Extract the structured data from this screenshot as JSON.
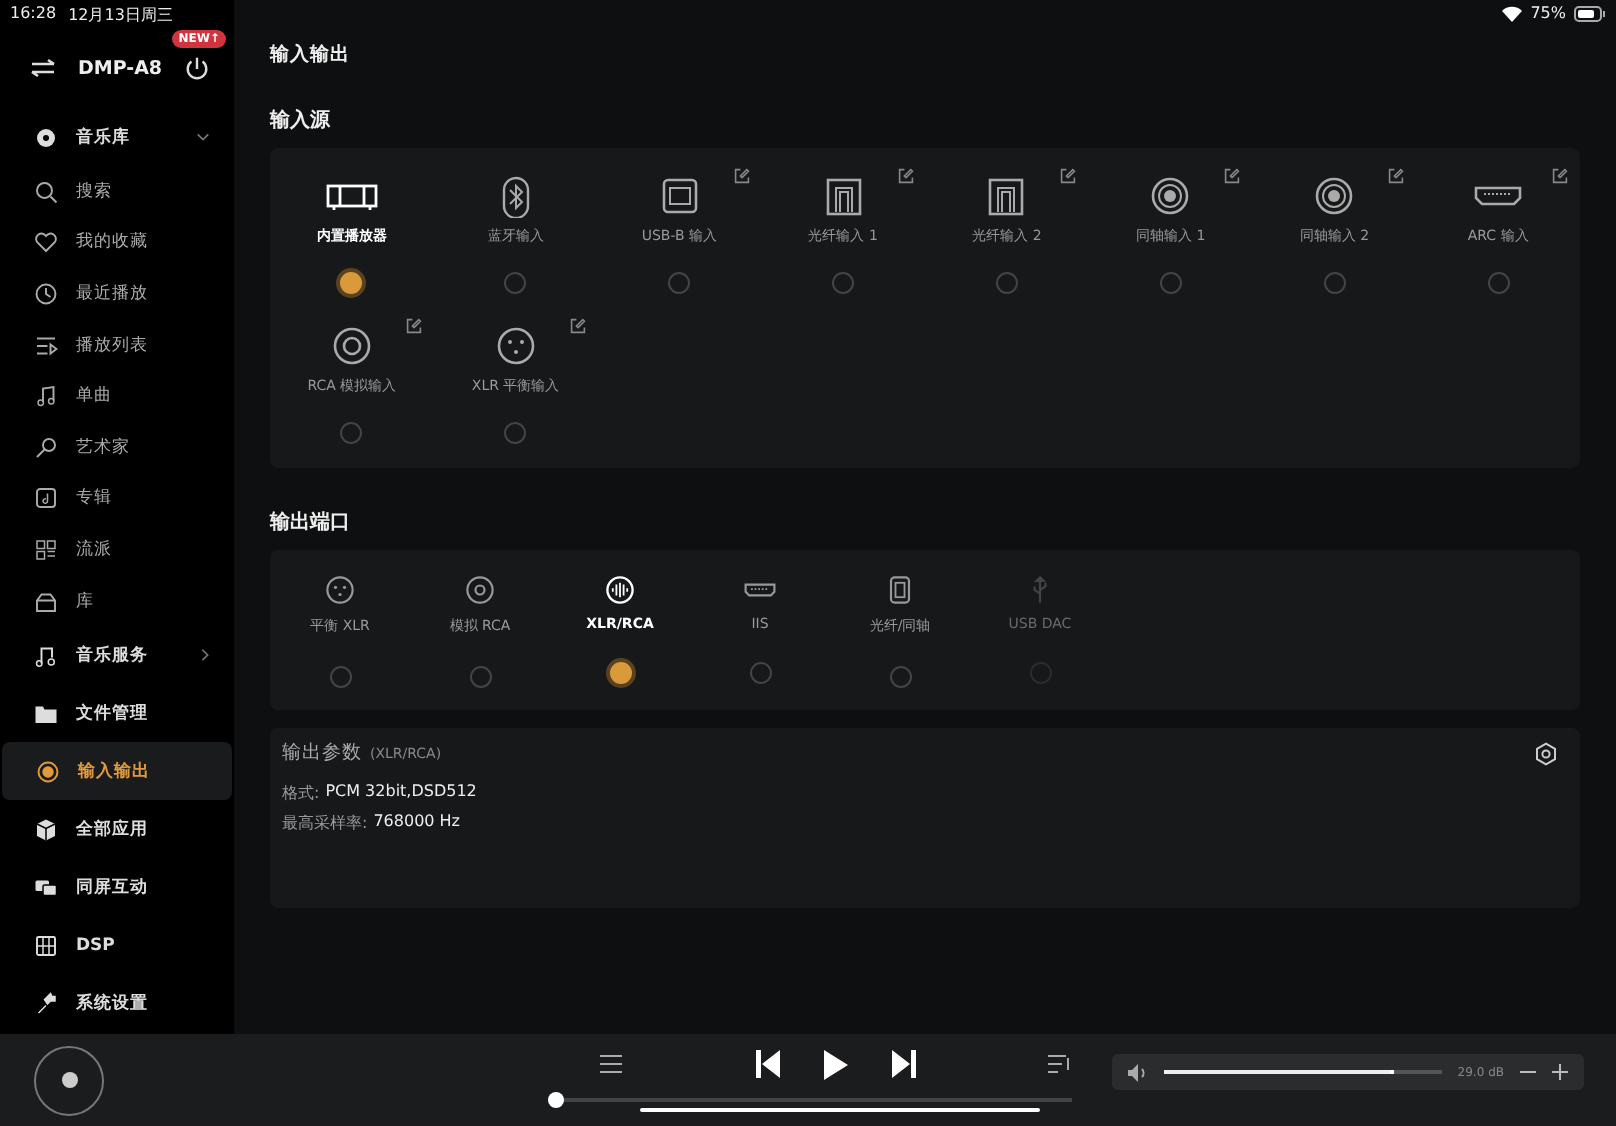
{
  "status_bar": {
    "time": "16:28",
    "date": "12月13日周三",
    "battery": "75%"
  },
  "sidebar": {
    "device": "DMP-A8",
    "badge": "NEW↑",
    "items": [
      {
        "label": "音乐库",
        "kind": "section",
        "expanded": true,
        "selected": false
      },
      {
        "label": "搜索",
        "kind": "item",
        "selected": false
      },
      {
        "label": "我的收藏",
        "kind": "item",
        "selected": false
      },
      {
        "label": "最近播放",
        "kind": "item",
        "selected": false
      },
      {
        "label": "播放列表",
        "kind": "item",
        "selected": false
      },
      {
        "label": "单曲",
        "kind": "item",
        "selected": false
      },
      {
        "label": "艺术家",
        "kind": "item",
        "selected": false
      },
      {
        "label": "专辑",
        "kind": "item",
        "selected": false
      },
      {
        "label": "流派",
        "kind": "item",
        "selected": false
      },
      {
        "label": "库",
        "kind": "item",
        "selected": false
      },
      {
        "label": "音乐服务",
        "kind": "section",
        "expanded": false,
        "selected": false
      },
      {
        "label": "文件管理",
        "kind": "section",
        "selected": false
      },
      {
        "label": "输入输出",
        "kind": "section",
        "selected": true
      },
      {
        "label": "全部应用",
        "kind": "section",
        "selected": false
      },
      {
        "label": "同屏互动",
        "kind": "section",
        "selected": false
      },
      {
        "label": "DSP",
        "kind": "section",
        "selected": false
      },
      {
        "label": "系统设置",
        "kind": "section",
        "selected": false
      }
    ]
  },
  "page_title": "输入输出",
  "inputs": {
    "heading": "输入源",
    "items": [
      {
        "label": "内置播放器",
        "editable": false,
        "selected": true
      },
      {
        "label": "蓝牙输入",
        "editable": false,
        "selected": false
      },
      {
        "label": "USB-B 输入",
        "editable": true,
        "selected": false
      },
      {
        "label": "光纤输入 1",
        "editable": true,
        "selected": false
      },
      {
        "label": "光纤输入 2",
        "editable": true,
        "selected": false
      },
      {
        "label": "同轴输入 1",
        "editable": true,
        "selected": false
      },
      {
        "label": "同轴输入 2",
        "editable": true,
        "selected": false
      },
      {
        "label": "ARC 输入",
        "editable": true,
        "selected": false
      },
      {
        "label": "RCA 模拟输入",
        "editable": true,
        "selected": false
      },
      {
        "label": "XLR 平衡输入",
        "editable": true,
        "selected": false
      }
    ]
  },
  "outputs": {
    "heading": "输出端口",
    "items": [
      {
        "label": "平衡 XLR",
        "disabled": false,
        "selected": false
      },
      {
        "label": "模拟 RCA",
        "disabled": false,
        "selected": false
      },
      {
        "label": "XLR/RCA",
        "disabled": false,
        "selected": true
      },
      {
        "label": "IIS",
        "disabled": false,
        "selected": false
      },
      {
        "label": "光纤/同轴",
        "disabled": false,
        "selected": false
      },
      {
        "label": "USB DAC",
        "disabled": true,
        "selected": false
      }
    ]
  },
  "output_params": {
    "title": "输出参数",
    "subtitle": "(XLR/RCA)",
    "rows": [
      {
        "label": "格式:",
        "value": "PCM 32bit,DSD512"
      },
      {
        "label": "最高采样率:",
        "value": "768000 Hz"
      }
    ]
  },
  "player": {
    "volume": {
      "level": 0.83,
      "reading": "29.0 dB"
    }
  }
}
